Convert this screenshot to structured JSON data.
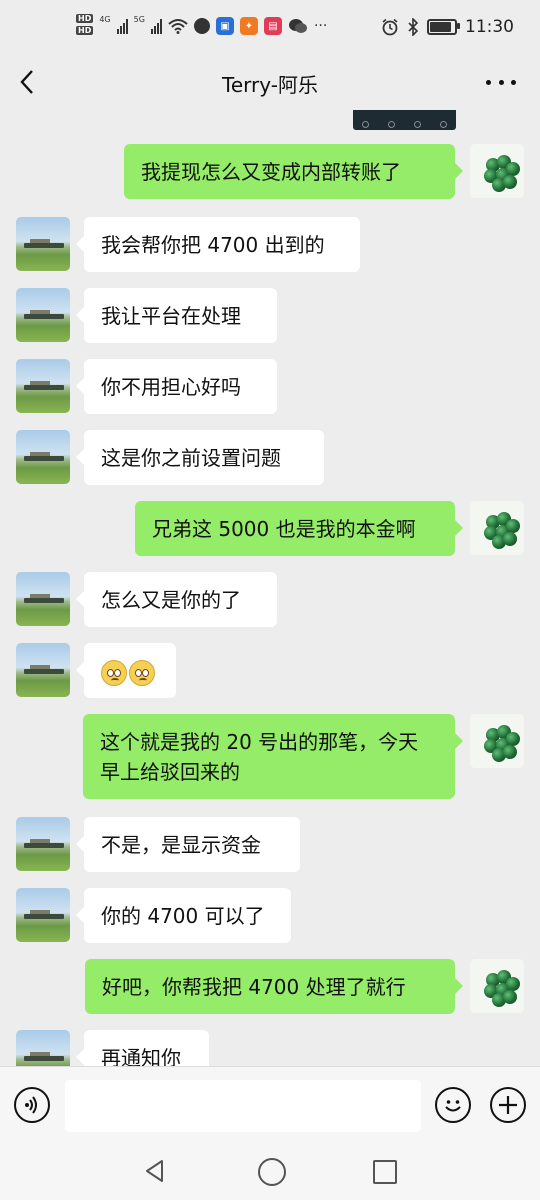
{
  "status_bar": {
    "time": "11:30",
    "hd1": "HD",
    "hd2": "HD",
    "net1": "4G",
    "net2": "5G",
    "icons": [
      "signal-icon",
      "signal-icon",
      "wifi-icon",
      "chat-bubble-icon",
      "app-icon",
      "app-icon",
      "app-icon",
      "wechat-icon",
      "more-dots-icon",
      "alarm-icon",
      "bluetooth-icon",
      "battery-icon"
    ],
    "battery_level": 0.95
  },
  "nav": {
    "title": "Terry-阿乐"
  },
  "messages": [
    {
      "side": "sent",
      "text": "我提现怎么又变成内部转账了"
    },
    {
      "side": "recv",
      "text": "我会帮你把 4700 出到的"
    },
    {
      "side": "recv",
      "text": "我让平台在处理"
    },
    {
      "side": "recv",
      "text": "你不用担心好吗"
    },
    {
      "side": "recv",
      "text": "这是你之前设置问题"
    },
    {
      "side": "sent",
      "text": "兄弟这 5000 也是我的本金啊"
    },
    {
      "side": "recv",
      "text": "怎么又是你的了"
    },
    {
      "side": "recv",
      "emoji": [
        "worried-face-emoji",
        "worried-face-emoji"
      ]
    },
    {
      "side": "sent",
      "text": "这个就是我的 20 号出的那笔，今天早上给驳回来的"
    },
    {
      "side": "recv",
      "text": "不是，是显示资金"
    },
    {
      "side": "recv",
      "text": "你的 4700 可以了"
    },
    {
      "side": "sent",
      "text": "好吧，你帮我把 4700 处理了就行"
    },
    {
      "side": "recv",
      "text": "再通知你"
    }
  ],
  "input": {
    "value": "",
    "placeholder": ""
  }
}
